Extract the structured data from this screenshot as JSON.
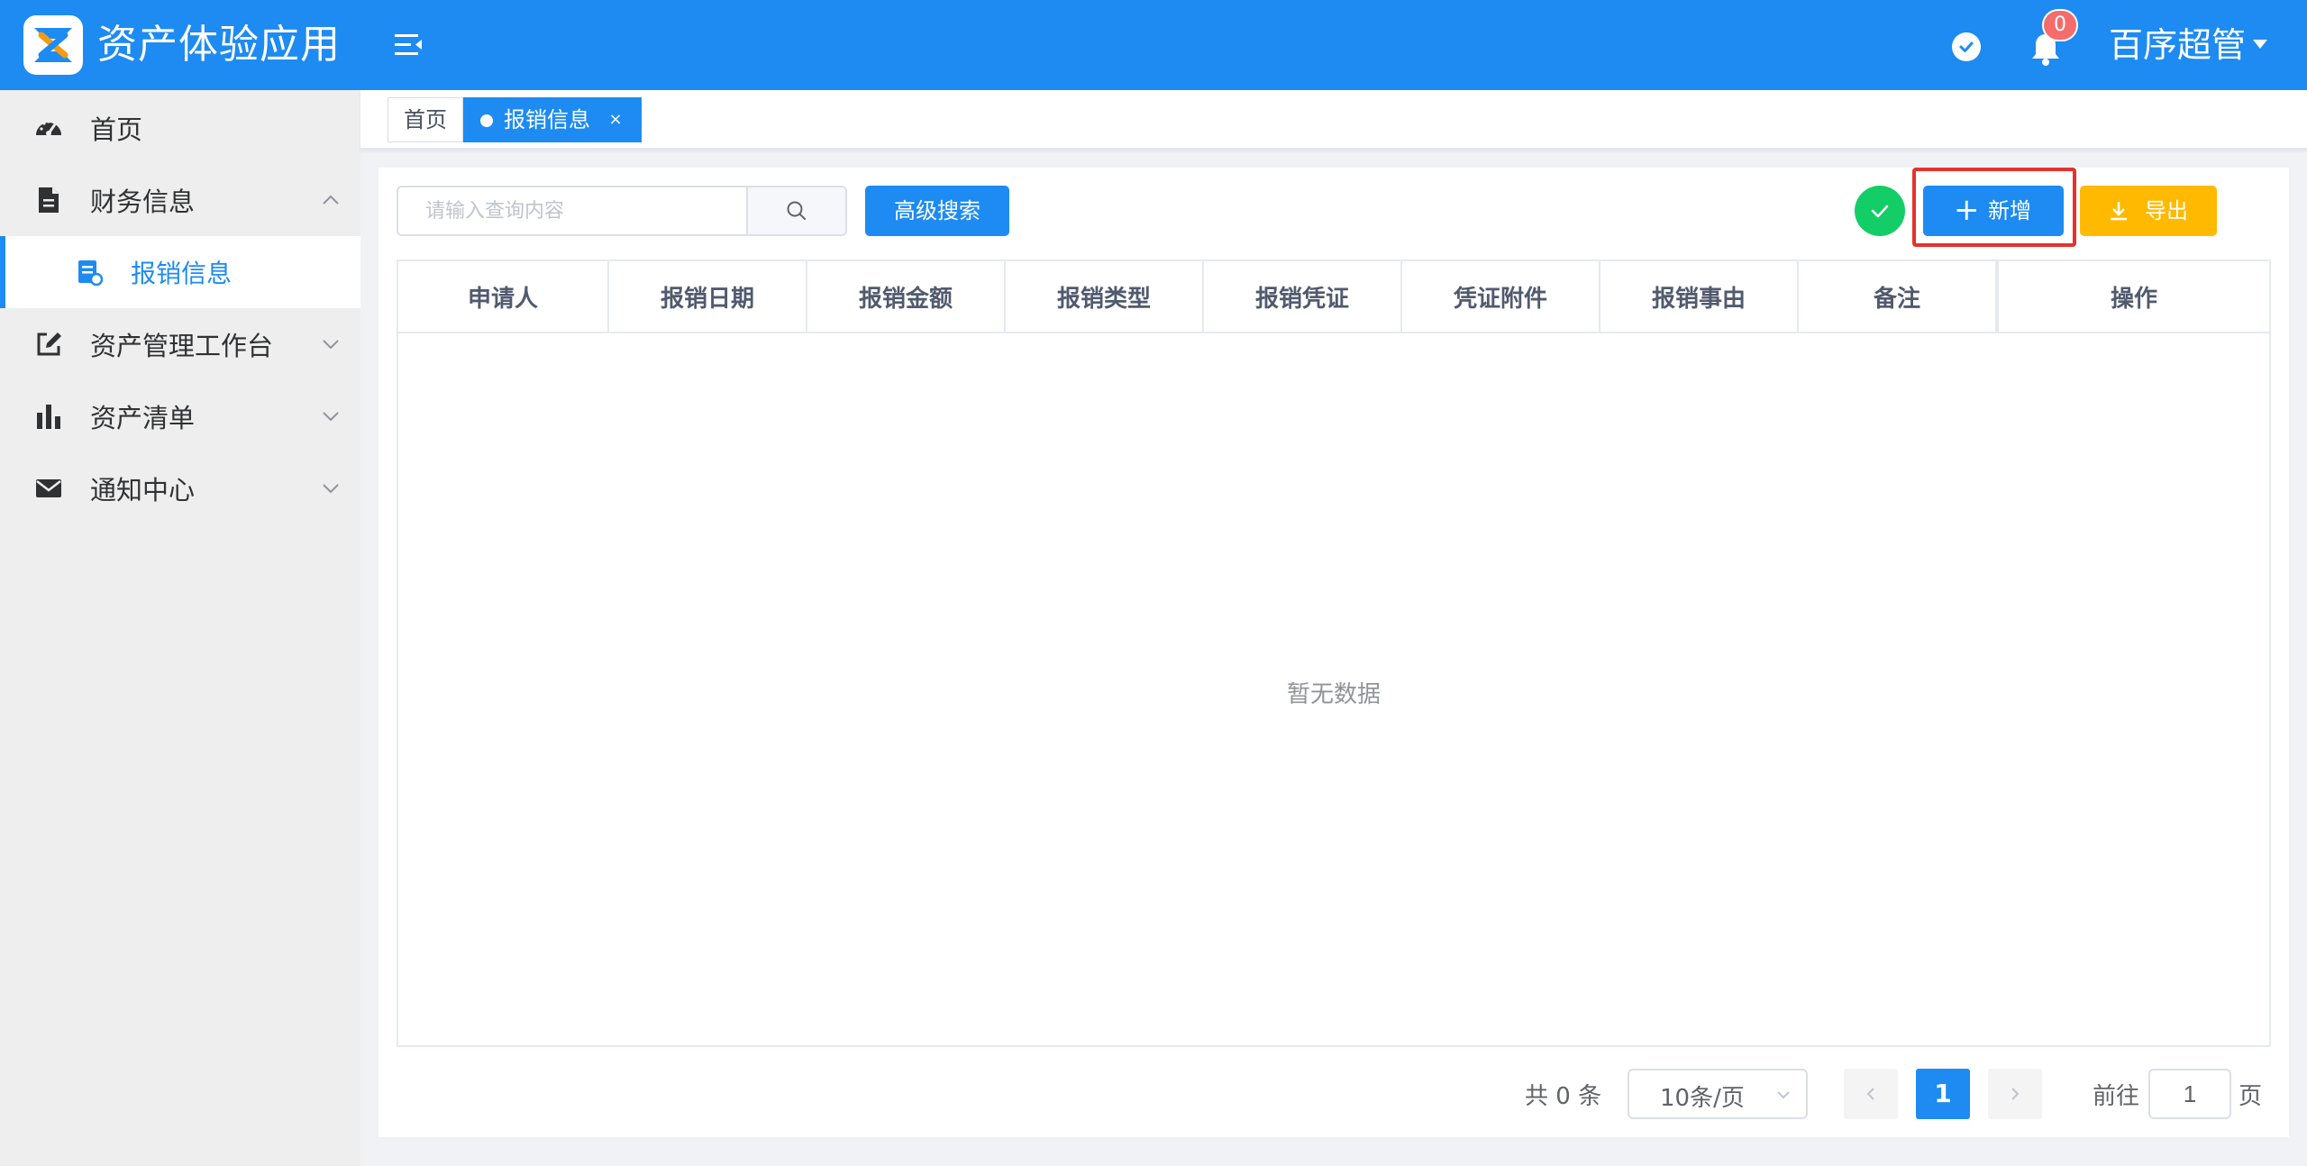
{
  "header": {
    "app_title": "资产体验应用",
    "notification_count": "0",
    "user_name": "百序超管"
  },
  "sidebar": {
    "items": [
      {
        "label": "首页",
        "icon": "dashboard-icon"
      },
      {
        "label": "财务信息",
        "icon": "document-icon",
        "expanded": true
      },
      {
        "label": "报销信息",
        "icon": "receipt-icon",
        "active": true
      },
      {
        "label": "资产管理工作台",
        "icon": "edit-icon"
      },
      {
        "label": "资产清单",
        "icon": "bar-chart-icon"
      },
      {
        "label": "通知中心",
        "icon": "envelope-icon"
      }
    ]
  },
  "tabs": {
    "home_label": "首页",
    "active_label": "报销信息",
    "close_glyph": "×"
  },
  "toolbar": {
    "search_placeholder": "请输入查询内容",
    "advanced_search_label": "高级搜索",
    "add_label": "新增",
    "export_label": "导出"
  },
  "table": {
    "columns": [
      "申请人",
      "报销日期",
      "报销金额",
      "报销类型",
      "报销凭证",
      "凭证附件",
      "报销事由",
      "备注",
      "操作"
    ],
    "empty_text": "暂无数据"
  },
  "pagination": {
    "total_text": "共 0 条",
    "page_size": "10条/页",
    "current_page": "1",
    "goto_label": "前往",
    "goto_value": "1",
    "page_suffix": "页"
  },
  "colors": {
    "primary": "#1d8bf1",
    "success": "#13ce66",
    "warning": "#ffba00",
    "highlight": "#e5322d",
    "danger": "#f56c6c"
  }
}
